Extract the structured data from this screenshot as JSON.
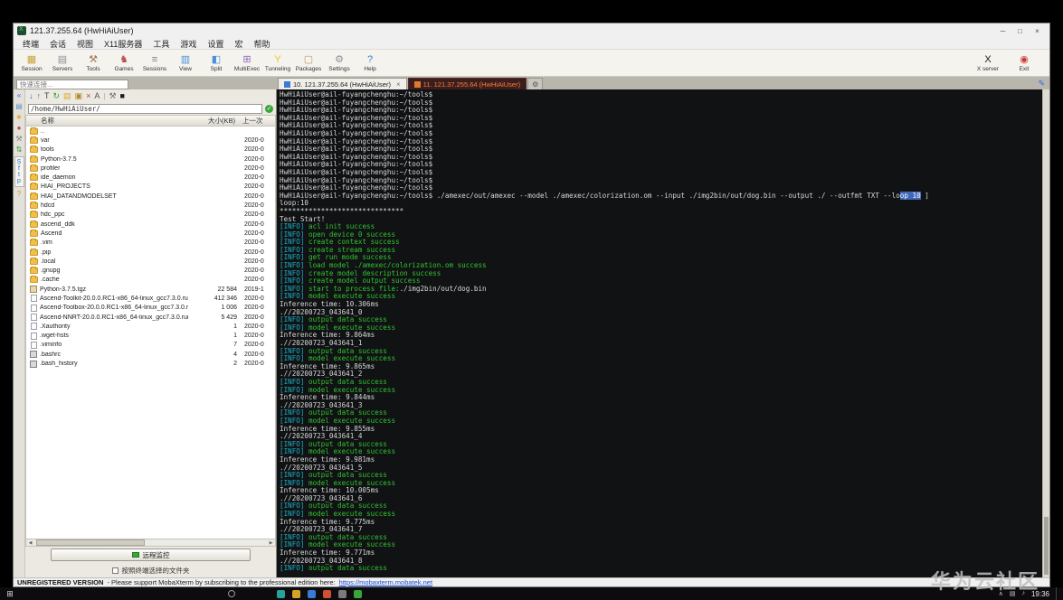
{
  "window": {
    "title": "121.37.255.64 (HwHiAiUser)",
    "controls": {
      "minimize": "─",
      "maximize": "□",
      "close": "×"
    }
  },
  "menubar": {
    "items": [
      "终端",
      "会话",
      "视图",
      "X11服务器",
      "工具",
      "游戏",
      "设置",
      "宏",
      "帮助"
    ]
  },
  "toolbar": {
    "buttons": [
      {
        "name": "session",
        "label": "Session",
        "glyph": "▦",
        "color": "#c9a23a"
      },
      {
        "name": "servers",
        "label": "Servers",
        "glyph": "▤",
        "color": "#8a8f96"
      },
      {
        "name": "tools",
        "label": "Tools",
        "glyph": "⚒",
        "color": "#a07850"
      },
      {
        "name": "games",
        "label": "Games",
        "glyph": "♞",
        "color": "#c05050"
      },
      {
        "name": "sessions",
        "label": "Sessions",
        "glyph": "≡",
        "color": "#7a8288"
      },
      {
        "name": "view",
        "label": "View",
        "glyph": "▥",
        "color": "#4a90d9"
      },
      {
        "name": "split",
        "label": "Split",
        "glyph": "◧",
        "color": "#4a90d9"
      },
      {
        "name": "multiexec",
        "label": "MultiExec",
        "glyph": "⊞",
        "color": "#8a6bbf"
      },
      {
        "name": "tunneling",
        "label": "Tunneling",
        "glyph": "Y",
        "color": "#e8c32a"
      },
      {
        "name": "packages",
        "label": "Packages",
        "glyph": "▢",
        "color": "#b89a6a"
      },
      {
        "name": "settings",
        "label": "Settings",
        "glyph": "⚙",
        "color": "#8a9096"
      },
      {
        "name": "help",
        "label": "Help",
        "glyph": "?",
        "color": "#3a7bd5"
      }
    ],
    "right_buttons": [
      {
        "name": "x-server",
        "label": "X server",
        "glyph": "X",
        "color": "#1a1a1a"
      },
      {
        "name": "exit",
        "label": "Exit",
        "glyph": "◉",
        "color": "#cc3b30"
      }
    ]
  },
  "side_strip": {
    "icons": [
      {
        "name": "collapse-icon",
        "glyph": "«",
        "color": "#2a6fd6"
      },
      {
        "name": "servers-icon",
        "glyph": "▤",
        "color": "#5a8fd0"
      },
      {
        "name": "star-icon",
        "glyph": "★",
        "color": "#e0a81f"
      },
      {
        "name": "macros-icon",
        "glyph": "●",
        "color": "#c04545"
      },
      {
        "name": "tools-icon",
        "glyph": "⚒",
        "color": "#7a8088"
      },
      {
        "name": "transfer-icon",
        "glyph": "⇅",
        "color": "#2a9a2a"
      }
    ],
    "sftp_label": "Sftp",
    "help_icon": {
      "name": "help-icon",
      "glyph": "?",
      "color": "#d29a2a"
    }
  },
  "sidebar": {
    "quick_connect_placeholder": "快速连接...",
    "mini_toolbar": [
      {
        "name": "download-icon",
        "glyph": "↓",
        "color": "#2a72c8"
      },
      {
        "name": "upload-icon",
        "glyph": "↑",
        "color": "#2a72c8"
      },
      {
        "name": "terminal-follow-icon",
        "glyph": "T",
        "color": "#444444"
      },
      {
        "name": "refresh-icon",
        "glyph": "↻",
        "color": "#2a9a2a"
      },
      {
        "name": "new-folder-icon",
        "glyph": "▤",
        "color": "#d8a92a"
      },
      {
        "name": "copy-icon",
        "glyph": "▣",
        "color": "#b8862a"
      },
      {
        "name": "delete-icon",
        "glyph": "×",
        "color": "#cc3333"
      },
      {
        "name": "font-icon",
        "glyph": "A",
        "color": "#555555"
      },
      {
        "name": "separator",
        "glyph": "|",
        "color": "#aaaaaa"
      },
      {
        "name": "wrench-icon",
        "glyph": "⚒",
        "color": "#707070"
      },
      {
        "name": "stop-icon",
        "glyph": "■",
        "color": "#1a1a1a"
      }
    ],
    "path": "/home/HwHiAiUser/",
    "path_ok_icon": "✓",
    "columns": [
      "名称",
      "大小(KB)",
      "上一次"
    ],
    "files": [
      {
        "name": "..",
        "icon": "folder",
        "size": "",
        "date": ""
      },
      {
        "name": "var",
        "icon": "folder",
        "size": "",
        "date": "2020-0"
      },
      {
        "name": "tools",
        "icon": "folder",
        "size": "",
        "date": "2020-0"
      },
      {
        "name": "Python-3.7.5",
        "icon": "folder",
        "size": "",
        "date": "2020-0"
      },
      {
        "name": "profiler",
        "icon": "folder",
        "size": "",
        "date": "2020-0"
      },
      {
        "name": "ide_daemon",
        "icon": "folder",
        "size": "",
        "date": "2020-0"
      },
      {
        "name": "HIAI_PROJECTS",
        "icon": "folder",
        "size": "",
        "date": "2020-0"
      },
      {
        "name": "HIAI_DATANDMODELSET",
        "icon": "folder",
        "size": "",
        "date": "2020-0"
      },
      {
        "name": "hdcd",
        "icon": "folder",
        "size": "",
        "date": "2020-0"
      },
      {
        "name": "hdc_ppc",
        "icon": "folder",
        "size": "",
        "date": "2020-0"
      },
      {
        "name": "ascend_ddk",
        "icon": "folder",
        "size": "",
        "date": "2020-0"
      },
      {
        "name": "Ascend",
        "icon": "folder",
        "size": "",
        "date": "2020-0"
      },
      {
        "name": ".vim",
        "icon": "folder",
        "size": "",
        "date": "2020-0"
      },
      {
        "name": ".pip",
        "icon": "folder",
        "size": "",
        "date": "2020-0"
      },
      {
        "name": ".local",
        "icon": "folder",
        "size": "",
        "date": "2020-0"
      },
      {
        "name": ".gnupg",
        "icon": "folder",
        "size": "",
        "date": "2020-0"
      },
      {
        "name": ".cache",
        "icon": "folder",
        "size": "",
        "date": "2020-0"
      },
      {
        "name": "Python-3.7.5.tgz",
        "icon": "archive",
        "size": "22 584",
        "date": "2019-1"
      },
      {
        "name": "Ascend-Toolkit-20.0.0.RC1-x86_64-linux_gcc7.3.0.run",
        "icon": "file",
        "size": "412 346",
        "date": "2020-0"
      },
      {
        "name": "Ascend-Toolbox-20.0.0.RC1-x86_64-linux_gcc7.3.0.run",
        "icon": "file",
        "size": "1 006",
        "date": "2020-0"
      },
      {
        "name": "Ascend-NNRT-20.0.0.RC1-x86_64-linux_gcc7.3.0.run",
        "icon": "file",
        "size": "5 429",
        "date": "2020-0"
      },
      {
        "name": ".Xauthority",
        "icon": "file",
        "size": "1",
        "date": "2020-0"
      },
      {
        "name": ".wget-hsts",
        "icon": "file",
        "size": "1",
        "date": "2020-0"
      },
      {
        "name": ".viminfo",
        "icon": "file",
        "size": "7",
        "date": "2020-0"
      },
      {
        "name": ".bashrc",
        "icon": "script",
        "size": "4",
        "date": "2020-0"
      },
      {
        "name": ".bash_history",
        "icon": "script",
        "size": "2",
        "date": "2020-0"
      }
    ],
    "remote_monitor_label": "远程监控",
    "follow_terminal_label": "按照终端选择的文件夹"
  },
  "terminal": {
    "tabs": [
      {
        "label": "10. 121.37.255.64 (HwHiAiUser)",
        "state": "active",
        "icon_color": "#3a7bd5",
        "close": "×"
      },
      {
        "label": "11. 121.37.255.64 (HwHiAiUser)",
        "state": "alert",
        "icon_color": "#e07a2a"
      },
      {
        "label": "",
        "state": "gear",
        "glyph": "⚙"
      }
    ],
    "edit_icon": "✎",
    "lines": [
      [
        [
          "p",
          "HwHiAiUser@ail-fuyangchenghu:~/tools$"
        ]
      ],
      [
        [
          "p",
          "HwHiAiUser@ail-fuyangchenghu:~/tools$"
        ]
      ],
      [
        [
          "p",
          "HwHiAiUser@ail-fuyangchenghu:~/tools$"
        ]
      ],
      [
        [
          "p",
          "HwHiAiUser@ail-fuyangchenghu:~/tools$"
        ]
      ],
      [
        [
          "p",
          "HwHiAiUser@ail-fuyangchenghu:~/tools$"
        ]
      ],
      [
        [
          "p",
          "HwHiAiUser@ail-fuyangchenghu:~/tools$"
        ]
      ],
      [
        [
          "p",
          "HwHiAiUser@ail-fuyangchenghu:~/tools$"
        ]
      ],
      [
        [
          "p",
          "HwHiAiUser@ail-fuyangchenghu:~/tools$"
        ]
      ],
      [
        [
          "p",
          "HwHiAiUser@ail-fuyangchenghu:~/tools$"
        ]
      ],
      [
        [
          "p",
          "HwHiAiUser@ail-fuyangchenghu:~/tools$"
        ]
      ],
      [
        [
          "p",
          "HwHiAiUser@ail-fuyangchenghu:~/tools$"
        ]
      ],
      [
        [
          "p",
          "HwHiAiUser@ail-fuyangchenghu:~/tools$"
        ]
      ],
      [
        [
          "p",
          "HwHiAiUser@ail-fuyangchenghu:~/tools$"
        ]
      ],
      [
        [
          "p",
          "HwHiAiUser@ail-fuyangchenghu:~/tools$ ./amexec/out/amexec --model ./amexec/colorization.om --input ./img2bin/out/dog.bin --output ./ --outfmt TXT --lo"
        ],
        [
          "s",
          "op 10"
        ],
        [
          "p",
          " ]"
        ]
      ],
      [
        [
          "p",
          "loop:10"
        ]
      ],
      [
        [
          "p",
          "******************************"
        ]
      ],
      [
        [
          "p",
          "Test Start!"
        ]
      ],
      [
        [
          "i",
          "[INFO]"
        ],
        [
          "g",
          " acl init success"
        ]
      ],
      [
        [
          "i",
          "[INFO]"
        ],
        [
          "g",
          " open device 0 success"
        ]
      ],
      [
        [
          "i",
          "[INFO]"
        ],
        [
          "g",
          " create context success"
        ]
      ],
      [
        [
          "i",
          "[INFO]"
        ],
        [
          "g",
          " create stream success"
        ]
      ],
      [
        [
          "i",
          "[INFO]"
        ],
        [
          "g",
          " get run mode success"
        ]
      ],
      [
        [
          "i",
          "[INFO]"
        ],
        [
          "g",
          " load model ./amexec/colorization.om success"
        ]
      ],
      [
        [
          "i",
          "[INFO]"
        ],
        [
          "g",
          " create model description success"
        ]
      ],
      [
        [
          "i",
          "[INFO]"
        ],
        [
          "g",
          " create model output success"
        ]
      ],
      [
        [
          "i",
          "[INFO]"
        ],
        [
          "g",
          " start to process file:"
        ],
        [
          "p",
          "./img2bin/out/dog.bin"
        ]
      ],
      [
        [
          "i",
          "[INFO]"
        ],
        [
          "g",
          " model execute success"
        ]
      ],
      [
        [
          "p",
          "Inference time: 10.306ms"
        ]
      ],
      [
        [
          "p",
          ".//20200723_043641_0"
        ]
      ],
      [
        [
          "i",
          "[INFO]"
        ],
        [
          "g",
          " output data success"
        ]
      ],
      [
        [
          "i",
          "[INFO]"
        ],
        [
          "g",
          " model execute success"
        ]
      ],
      [
        [
          "p",
          "Inference time: 9.864ms"
        ]
      ],
      [
        [
          "p",
          ".//20200723_043641_1"
        ]
      ],
      [
        [
          "i",
          "[INFO]"
        ],
        [
          "g",
          " output data success"
        ]
      ],
      [
        [
          "i",
          "[INFO]"
        ],
        [
          "g",
          " model execute success"
        ]
      ],
      [
        [
          "p",
          "Inference time: 9.865ms"
        ]
      ],
      [
        [
          "p",
          ".//20200723_043641_2"
        ]
      ],
      [
        [
          "i",
          "[INFO]"
        ],
        [
          "g",
          " output data success"
        ]
      ],
      [
        [
          "i",
          "[INFO]"
        ],
        [
          "g",
          " model execute success"
        ]
      ],
      [
        [
          "p",
          "Inference time: 9.844ms"
        ]
      ],
      [
        [
          "p",
          ".//20200723_043641_3"
        ]
      ],
      [
        [
          "i",
          "[INFO]"
        ],
        [
          "g",
          " output data success"
        ]
      ],
      [
        [
          "i",
          "[INFO]"
        ],
        [
          "g",
          " model execute success"
        ]
      ],
      [
        [
          "p",
          "Inference time: 9.855ms"
        ]
      ],
      [
        [
          "p",
          ".//20200723_043641_4"
        ]
      ],
      [
        [
          "i",
          "[INFO]"
        ],
        [
          "g",
          " output data success"
        ]
      ],
      [
        [
          "i",
          "[INFO]"
        ],
        [
          "g",
          " model execute success"
        ]
      ],
      [
        [
          "p",
          "Inference time: 9.981ms"
        ]
      ],
      [
        [
          "p",
          ".//20200723_043641_5"
        ]
      ],
      [
        [
          "i",
          "[INFO]"
        ],
        [
          "g",
          " output data success"
        ]
      ],
      [
        [
          "i",
          "[INFO]"
        ],
        [
          "g",
          " model execute success"
        ]
      ],
      [
        [
          "p",
          "Inference time: 10.005ms"
        ]
      ],
      [
        [
          "p",
          ".//20200723_043641_6"
        ]
      ],
      [
        [
          "i",
          "[INFO]"
        ],
        [
          "g",
          " output data success"
        ]
      ],
      [
        [
          "i",
          "[INFO]"
        ],
        [
          "g",
          " model execute success"
        ]
      ],
      [
        [
          "p",
          "Inference time: 9.775ms"
        ]
      ],
      [
        [
          "p",
          ".//20200723_043641_7"
        ]
      ],
      [
        [
          "i",
          "[INFO]"
        ],
        [
          "g",
          " output data success"
        ]
      ],
      [
        [
          "i",
          "[INFO]"
        ],
        [
          "g",
          " model execute success"
        ]
      ],
      [
        [
          "p",
          "Inference time: 9.771ms"
        ]
      ],
      [
        [
          "p",
          ".//20200723_043641_8"
        ]
      ],
      [
        [
          "i",
          "[INFO]"
        ],
        [
          "g",
          " output data success"
        ]
      ]
    ]
  },
  "statusbar": {
    "unregistered": "UNREGISTERED VERSION",
    "message": "-  Please support MobaXterm by subscribing to the professional edition here:",
    "link": "https://mobaxterm.mobatek.net"
  },
  "taskbar": {
    "start_glyph": "⊞",
    "app_colors": [
      "#2aa198",
      "#d7a22a",
      "#3a7bd5",
      "#d05030",
      "#7a7a7a",
      "#3aa63a"
    ],
    "tray_icons": [
      "∧",
      "▤",
      "♪"
    ],
    "time": "19:36"
  },
  "watermark": "华为云社区"
}
